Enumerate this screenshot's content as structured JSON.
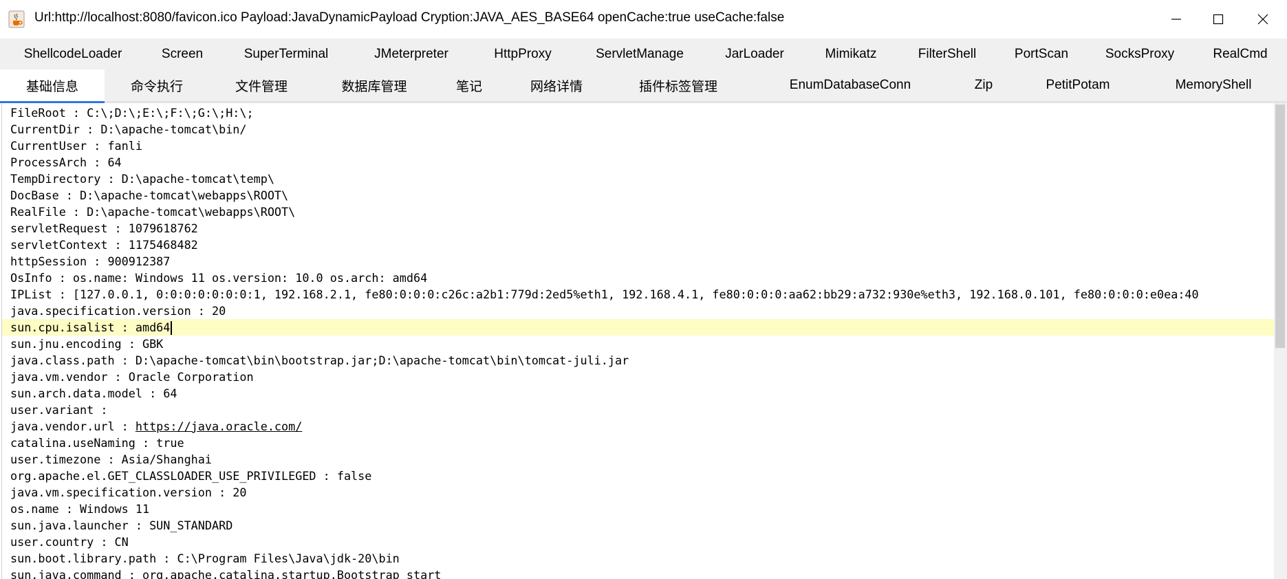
{
  "window": {
    "title": "Url:http://localhost:8080/favicon.ico Payload:JavaDynamicPayload Cryption:JAVA_AES_BASE64 openCache:true useCache:false"
  },
  "tabs_row1": [
    "ShellcodeLoader",
    "Screen",
    "SuperTerminal",
    "JMeterpreter",
    "HttpProxy",
    "ServletManage",
    "JarLoader",
    "Mimikatz",
    "FilterShell",
    "PortScan",
    "SocksProxy",
    "RealCmd"
  ],
  "tabs_row2": [
    "基础信息",
    "命令执行",
    "文件管理",
    "数据库管理",
    "笔记",
    "网络详情",
    "插件标签管理",
    "EnumDatabaseConn",
    "Zip",
    "PetitPotam",
    "MemoryShell"
  ],
  "active_tab": "基础信息",
  "info": {
    "lines": [
      "FileRoot : C:\\;D:\\;E:\\;F:\\;G:\\;H:\\;",
      "CurrentDir : D:\\apache-tomcat\\bin/",
      "CurrentUser : fanli",
      "ProcessArch : 64",
      "TempDirectory : D:\\apache-tomcat\\temp\\",
      "DocBase : D:\\apache-tomcat\\webapps\\ROOT\\",
      "RealFile : D:\\apache-tomcat\\webapps\\ROOT\\",
      "servletRequest : 1079618762",
      "servletContext : 1175468482",
      "httpSession : 900912387",
      "OsInfo : os.name: Windows 11 os.version: 10.0 os.arch: amd64",
      "IPList : [127.0.0.1, 0:0:0:0:0:0:0:1, 192.168.2.1, fe80:0:0:0:c26c:a2b1:779d:2ed5%eth1, 192.168.4.1, fe80:0:0:0:aa62:bb29:a732:930e%eth3, 192.168.0.101, fe80:0:0:0:e0ea:40",
      "java.specification.version : 20",
      "sun.cpu.isalist : amd64",
      "sun.jnu.encoding : GBK",
      "java.class.path : D:\\apache-tomcat\\bin\\bootstrap.jar;D:\\apache-tomcat\\bin\\tomcat-juli.jar",
      "java.vm.vendor : Oracle Corporation",
      "sun.arch.data.model : 64",
      "user.variant : ",
      "java.vendor.url : ",
      "catalina.useNaming : true",
      "user.timezone : Asia/Shanghai",
      "org.apache.el.GET_CLASSLOADER_USE_PRIVILEGED : false",
      "java.vm.specification.version : 20",
      "os.name : Windows 11",
      "sun.java.launcher : SUN_STANDARD",
      "user.country : CN",
      "sun.boot.library.path : C:\\Program Files\\Java\\jdk-20\\bin",
      "sun.java.command : org.apache.catalina.startup.Bootstrap start"
    ],
    "vendor_url": "https://java.oracle.com/",
    "highlight_line": 13,
    "link_line": 19
  },
  "colors": {
    "highlight": "#fdfdc4",
    "active_tab_underline": "#2b78e4",
    "tab_bar_bg": "#f0f0f0"
  },
  "icons": [
    "java-cup-icon",
    "minimize-icon",
    "maximize-icon",
    "close-icon"
  ]
}
